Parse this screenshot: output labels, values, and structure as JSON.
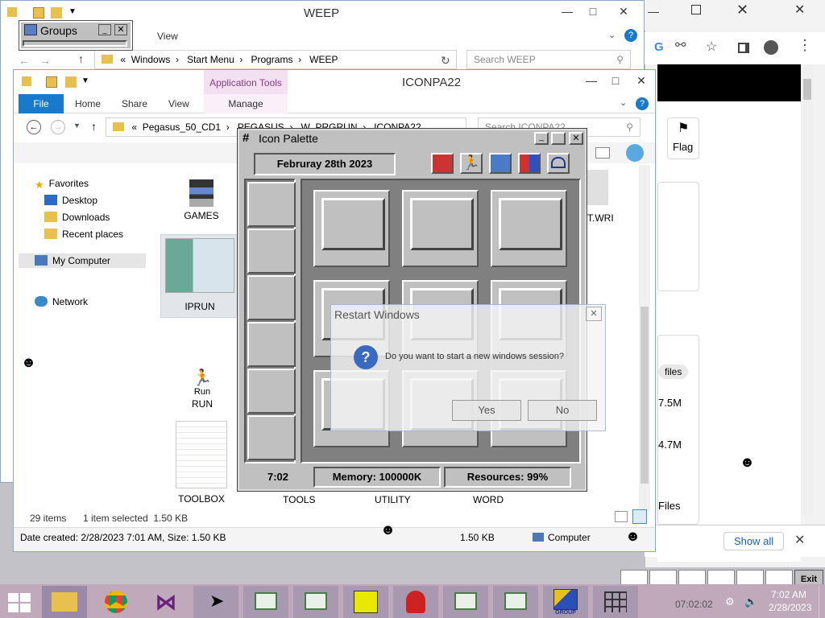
{
  "weep_window": {
    "title": "WEEP",
    "tabs": [
      "View"
    ],
    "breadcrumb": [
      "«",
      "Windows",
      "Start Menu",
      "Programs",
      "WEEP"
    ],
    "search_placeholder": "Search WEEP"
  },
  "groups_window": {
    "title": "Groups"
  },
  "explorer": {
    "title": "ICONPA22",
    "context_tab": "Application Tools",
    "tabs": [
      "File",
      "Home",
      "Share",
      "View",
      "Manage"
    ],
    "breadcrumb": [
      "«",
      "Pegasus_50_CD1",
      "PEGASUS",
      "W_PRGRUN",
      "ICONPA22"
    ],
    "search_placeholder": "Search ICONPA22",
    "nav": [
      "Favorites",
      "Desktop",
      "Downloads",
      "Recent places",
      "My Computer",
      "Network"
    ],
    "files": [
      "GAMES",
      "IPRUN",
      "Run",
      "RUN",
      "TOOLBOX",
      "TOOLS",
      "UTILITY",
      "WORD",
      "T.WRI"
    ],
    "status_items": "29 items",
    "status_selected": "1 item selected  1.50 KB",
    "details": "Date created: 2/28/2023 7:01 AM, Size: 1.50 KB",
    "details_size": "1.50 KB",
    "details_location": "Computer"
  },
  "palette": {
    "title": "Icon Palette",
    "date": "Februray 28th 2023",
    "time": "7:02",
    "memory": "Memory: 100000K",
    "resources": "Resources: 99%",
    "toolbar_icons": [
      "dos-icon",
      "run-icon",
      "control-icon",
      "windows-icon",
      "exit-icon"
    ]
  },
  "dialog": {
    "title": "Restart Windows",
    "message": "Do you want to start a new windows session?",
    "yes": "Yes",
    "no": "No"
  },
  "chrome": {
    "flag": "Flag",
    "files_chip": "files",
    "size1": "7.5M",
    "size2": "4.7M",
    "files_label": "Files",
    "show_all": "Show all"
  },
  "taskbar": {
    "clock_time": "7:02 AM",
    "clock_date": "2/28/2023",
    "ghost_time": "07:02:02",
    "exit": "Exit",
    "group_label": "GROUP"
  },
  "colors": {
    "accent": "#1979ca",
    "palette_gray": "#c0c0c0",
    "taskbar": "#bfa9bb"
  }
}
